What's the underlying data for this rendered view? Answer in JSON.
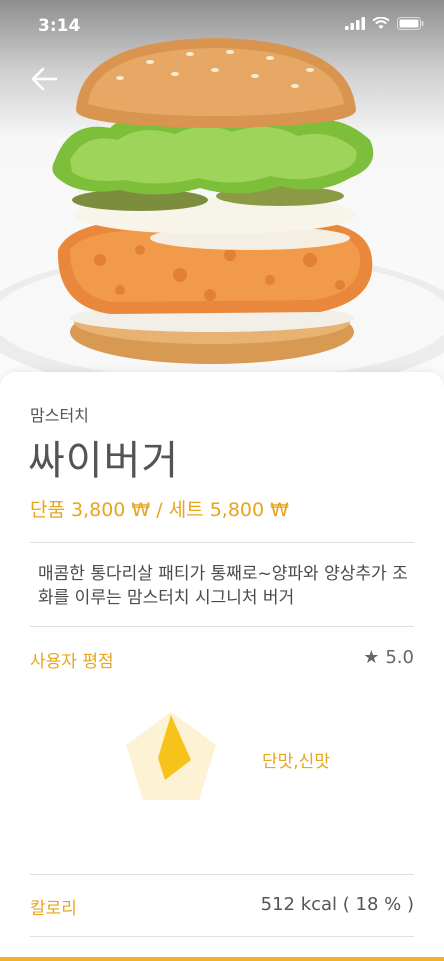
{
  "status_bar": {
    "time": "3:14"
  },
  "product": {
    "brand": "맘스터치",
    "name": "싸이버거",
    "price": "단품 3,800 ₩ / 세트 5,800 ₩",
    "description": "매콤한 통다리살 패티가 통째로~양파와 양상추가 조화를 이루는 맘스터치 시그니처 버거"
  },
  "rating": {
    "label": "사용자 평점",
    "star": "★",
    "value": "5.0"
  },
  "taste": {
    "label": "단맛,신맛"
  },
  "calorie": {
    "label": "칼로리",
    "value": "512 kcal ( 18 % )"
  },
  "colors": {
    "accent": "#e7a51c",
    "chart_fill": "#f6c21c",
    "chart_bg": "#fdf2d3"
  }
}
